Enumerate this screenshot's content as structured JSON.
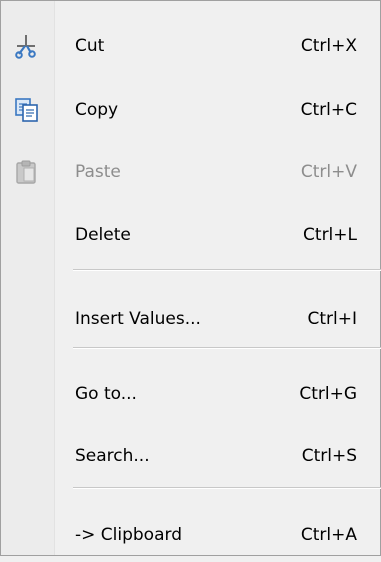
{
  "context_menu": {
    "items": [
      {
        "label": "Cut",
        "shortcut": "Ctrl+X",
        "icon": "scissors-icon",
        "enabled": true
      },
      {
        "label": "Copy",
        "shortcut": "Ctrl+C",
        "icon": "copy-icon",
        "enabled": true
      },
      {
        "label": "Paste",
        "shortcut": "Ctrl+V",
        "icon": "clipboard-icon",
        "enabled": false
      },
      {
        "label": "Delete",
        "shortcut": "Ctrl+L",
        "icon": null,
        "enabled": true
      },
      {
        "label": "Insert Values...",
        "shortcut": "Ctrl+I",
        "icon": null,
        "enabled": true
      },
      {
        "label": "Go to...",
        "shortcut": "Ctrl+G",
        "icon": null,
        "enabled": true
      },
      {
        "label": "Search...",
        "shortcut": "Ctrl+S",
        "icon": null,
        "enabled": true
      },
      {
        "label": "-> Clipboard",
        "shortcut": "Ctrl+A",
        "icon": null,
        "enabled": true
      }
    ]
  },
  "colors": {
    "menu_background": "#f0f0f0",
    "disabled_text": "#8d8d8d",
    "icon_blue": "#3a78c2"
  }
}
